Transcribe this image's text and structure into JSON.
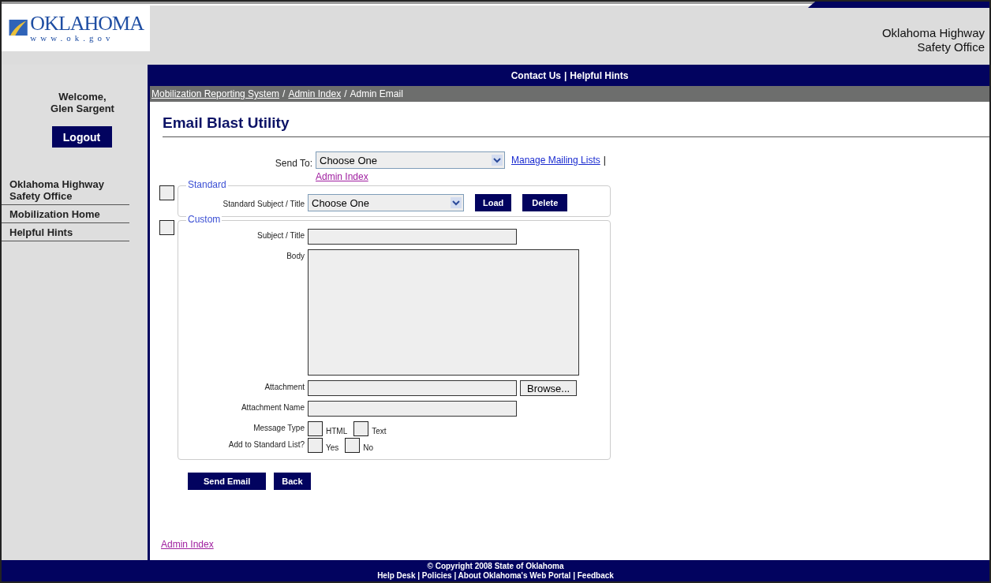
{
  "header": {
    "logo_text": "OKLAHOMA",
    "logo_url": "www.ok.gov",
    "agency": [
      "Oklahoma Highway",
      "Safety Office"
    ]
  },
  "nav_bar": {
    "links": [
      "Contact Us",
      "Helpful Hints"
    ],
    "separator": "|"
  },
  "sidebar": {
    "welcome": "Welcome,",
    "user": "Glen Sargent",
    "logout": "Logout",
    "items": [
      "Oklahoma Highway Safety Office",
      "Mobilization Home",
      "Helpful Hints"
    ]
  },
  "breadcrumb": {
    "separator": "/",
    "items": [
      {
        "label": "Mobilization Reporting System",
        "link": true
      },
      {
        "label": "Admin Index",
        "link": true
      },
      {
        "label": "Admin Email",
        "link": false
      }
    ]
  },
  "page_title": "Email Blast Utility",
  "send_to": {
    "label": "Send To:",
    "value": "Choose One",
    "links": [
      "Manage Mailing Lists",
      "Admin Index"
    ],
    "separator": "|"
  },
  "standard": {
    "legend": "Standard",
    "selected": false,
    "label": "Standard Subject / Title",
    "value": "Choose One",
    "buttons": [
      "Load",
      "Delete"
    ]
  },
  "custom": {
    "legend": "Custom",
    "selected": false,
    "subject_label": "Subject / Title",
    "body_label": "Body",
    "attachment_label": "Attachment",
    "browse": "Browse...",
    "attachment_name_label": "Attachment Name",
    "message_type": {
      "label": "Message Type",
      "options": [
        {
          "label": "HTML",
          "selected": false
        },
        {
          "label": "Text",
          "selected": false
        }
      ]
    },
    "add_to_list": {
      "label": "Add to Standard List?",
      "options": [
        {
          "label": "Yes",
          "selected": false
        },
        {
          "label": "No",
          "selected": false
        }
      ]
    }
  },
  "actions": [
    "Send Email",
    "Back"
  ],
  "bottom_link": "Admin Index",
  "footer": {
    "copyright": "© Copyright 2008 State of Oklahoma",
    "links": "Help Desk | Policies | About Oklahoma's Web Portal | Feedback"
  }
}
